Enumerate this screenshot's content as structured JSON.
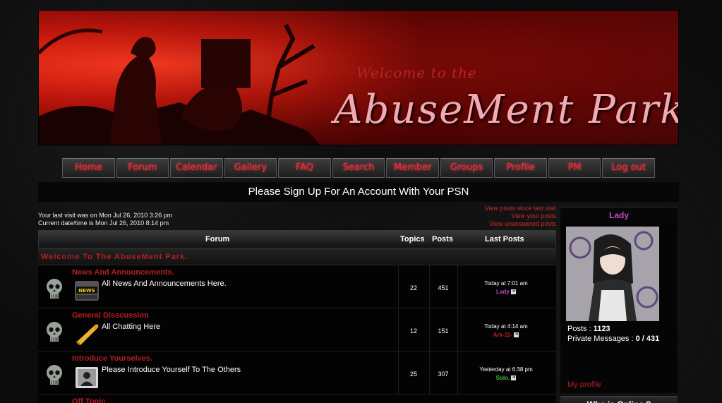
{
  "banner": {
    "welcome": "Welcome to the",
    "title": "AbuseMent Park"
  },
  "nav": [
    "Home",
    "Forum",
    "Calendar",
    "Gallery",
    "FAQ",
    "Search",
    "Member",
    "Groups",
    "Profile",
    "PM",
    "Log out"
  ],
  "notice": "Please Sign Up For An Account With Your PSN",
  "visit": {
    "last_visit": "Your last visit was on Mon Jul 26, 2010 3:26 pm",
    "current_time": "Current date/time is Mon Jul 26, 2010 8:14 pm"
  },
  "view_links": [
    "View posts since last visit",
    "View your posts",
    "View unanswered posts"
  ],
  "table": {
    "headers": {
      "forum": "Forum",
      "topics": "Topics",
      "posts": "Posts",
      "last_posts": "Last Posts"
    },
    "category": "Welcome To The AbuseMent Park.",
    "rows": [
      {
        "title": "News And Announcements.",
        "desc": "All News And Announcements Here.",
        "topics": "22",
        "posts": "451",
        "last_time": "Today at 7:01 am",
        "last_user": "Lady",
        "user_color": "#c24bc2",
        "icon": "news-icon"
      },
      {
        "title": "General Disscussion",
        "desc": "All Chatting Here",
        "topics": "12",
        "posts": "151",
        "last_time": "Today at 4:14 am",
        "last_user": "Ark-22-",
        "user_color": "#b41e22",
        "icon": "megaphone-icon"
      },
      {
        "title": "Introduce Yourselves.",
        "desc": "Please Introduce Yourself To The Others",
        "topics": "25",
        "posts": "307",
        "last_time": "Yesterday at 6:38 pm",
        "last_user": "Solo.",
        "user_color": "#3fbf3f",
        "icon": "user-folder-icon"
      }
    ],
    "next_partial": "Off Topic"
  },
  "sidebar": {
    "username": "Lady",
    "posts_label": "Posts :",
    "posts_value": "1123",
    "pm_label": "Private Messages :",
    "pm_value": "0 / 431",
    "my_profile": "My profile",
    "who_online": "Who is Online ?"
  }
}
